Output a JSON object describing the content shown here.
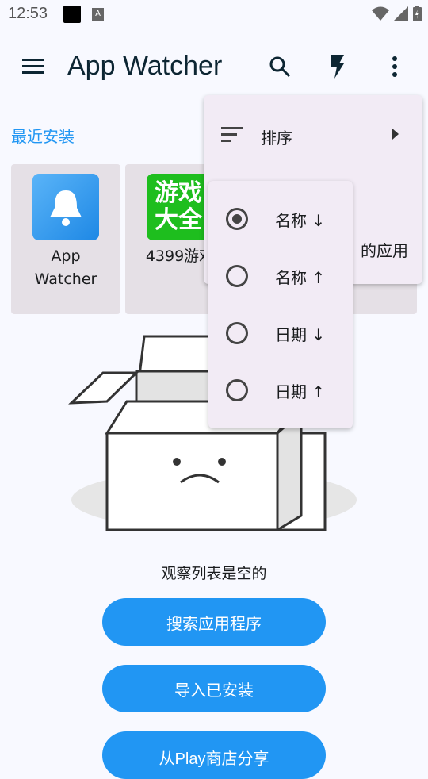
{
  "status_bar": {
    "time": "12:53",
    "notification_icon": "A"
  },
  "app_bar": {
    "title": "App Watcher",
    "icons": [
      "menu-icon",
      "search-icon",
      "flash-icon",
      "more-vert-icon"
    ]
  },
  "section_title": "最近安装",
  "recent_apps": [
    {
      "name": "App\nWatcher"
    },
    {
      "name": "4399游戏"
    }
  ],
  "empty_state": {
    "text": "观察列表是空的"
  },
  "buttons": {
    "search": "搜索应用程序",
    "import": "导入已安装",
    "share": "从Play商店分享"
  },
  "overflow_menu": {
    "sort_label": "排序",
    "partial_item": "的应用"
  },
  "sort_menu": {
    "options": [
      {
        "label": "名称 ↓",
        "selected": true
      },
      {
        "label": "名称 ↑",
        "selected": false
      },
      {
        "label": "日期 ↓",
        "selected": false
      },
      {
        "label": "日期 ↑",
        "selected": false
      }
    ]
  },
  "colors": {
    "accent": "#2196f3",
    "menu_bg": "#f2ebf5",
    "card_bg": "#e5e0e6"
  }
}
